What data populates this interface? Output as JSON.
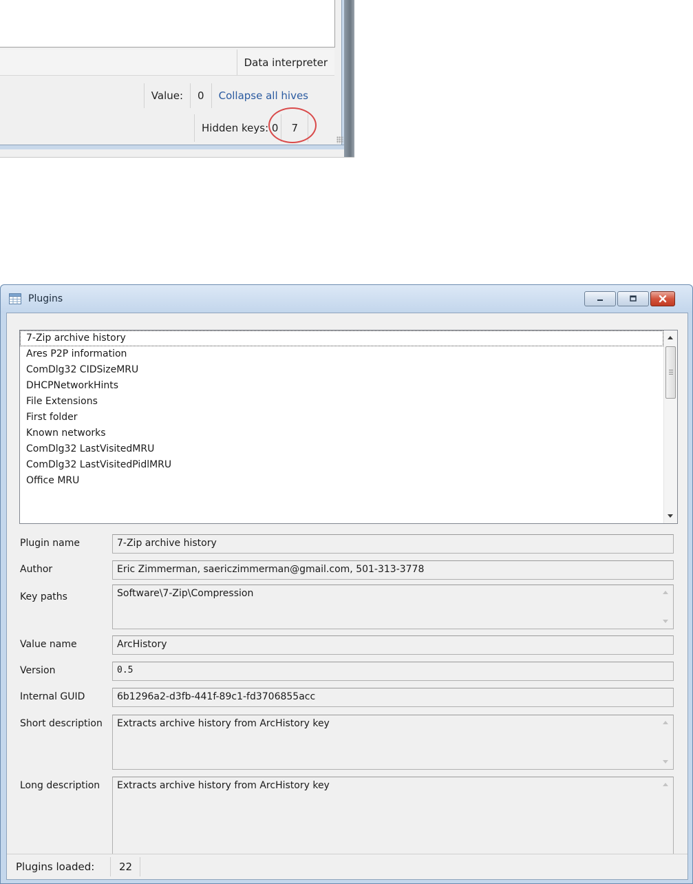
{
  "main_window_crop": {
    "data_interpreter_label": "Data interpreter",
    "value_label": "Value:",
    "value_count": "0",
    "collapse_all_label": "Collapse all hives",
    "hidden_keys_label": "Hidden keys: 0",
    "hidden_keys_count": "7",
    "highlight_color": "#d94a4a"
  },
  "plugins_window": {
    "title": "Plugins",
    "list_items": [
      "7-Zip archive history",
      "Ares P2P information",
      "ComDlg32 CIDSizeMRU",
      "DHCPNetworkHints",
      "File Extensions",
      "First folder",
      "Known networks",
      "ComDlg32 LastVisitedMRU",
      "ComDlg32 LastVisitedPidlMRU",
      "Office MRU"
    ],
    "selected_index": 0,
    "fields": {
      "plugin_name": {
        "label": "Plugin name",
        "value": "7-Zip archive history"
      },
      "author": {
        "label": "Author",
        "value": "Eric Zimmerman, saericzimmerman@gmail.com, 501-313-3778"
      },
      "key_paths": {
        "label": "Key paths",
        "value": "Software\\7-Zip\\Compression"
      },
      "value_name": {
        "label": "Value name",
        "value": "ArcHistory"
      },
      "version": {
        "label": "Version",
        "value": "0.5"
      },
      "internal_guid": {
        "label": "Internal GUID",
        "value": "6b1296a2-d3fb-441f-89c1-fd3706855acc"
      },
      "short_description": {
        "label": "Short description",
        "value": "Extracts archive history from ArcHistory key"
      },
      "long_description": {
        "label": "Long description",
        "value": "Extracts archive history from ArcHistory key"
      }
    },
    "status": {
      "plugins_loaded_label": "Plugins loaded:",
      "plugins_loaded_count": "22"
    }
  }
}
